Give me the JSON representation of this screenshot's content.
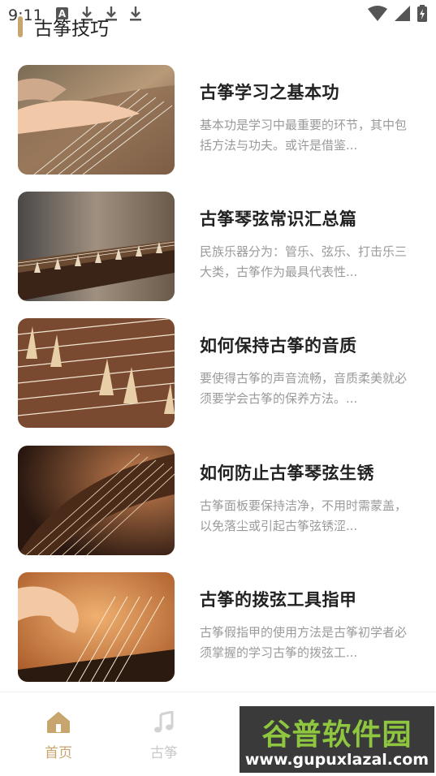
{
  "status_bar": {
    "time": "9:11",
    "left_icons": [
      "a-icon",
      "download-icon",
      "download-icon",
      "download-icon"
    ],
    "right_icons": [
      "wifi-icon",
      "signal-icon",
      "battery-charging-icon"
    ]
  },
  "header": {
    "title": "古筝技巧"
  },
  "articles": [
    {
      "title": "古筝学习之基本功",
      "desc": "基本功是学习中最重要的环节，其中包括方法与功夫。或许是借鉴..."
    },
    {
      "title": "古筝琴弦常识汇总篇",
      "desc": "民族乐器分为：管乐、弦乐、打击乐三大类，古筝作为最具代表性..."
    },
    {
      "title": "如何保持古筝的音质",
      "desc": "要使得古筝的声音流畅，音质柔美就必须要学会古筝的保养方法。..."
    },
    {
      "title": "如何防止古筝琴弦生锈",
      "desc": "古筝面板要保持洁净，不用时需蒙盖，以免落尘或引起古筝弦锈涩..."
    },
    {
      "title": "古筝的拨弦工具指甲",
      "desc": "古筝假指甲的使用方法是古筝初学者必须掌握的学习古筝的拨弦工..."
    }
  ],
  "bottom_nav": {
    "home_label": "首页",
    "guzheng_label": "古筝",
    "home_icon": "home-icon",
    "guzheng_icon": "music-note-icon",
    "active_color": "#c8a46e",
    "inactive_color": "#c9c9c9"
  },
  "watermark": {
    "title": "谷普软件园",
    "url": "www.gupuxlazal.com"
  }
}
